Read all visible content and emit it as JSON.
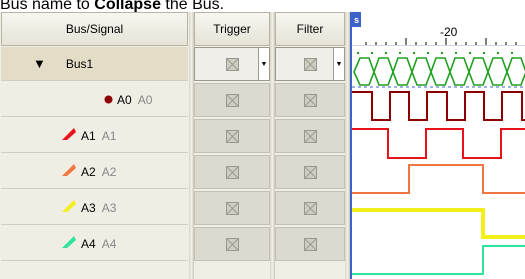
{
  "caption": {
    "prefix": "Bus name to ",
    "action": "Collapse",
    "suffix": " the Bus."
  },
  "headers": {
    "bus_signal": "Bus/Signal",
    "trigger": "Trigger",
    "filter": "Filter"
  },
  "bus": {
    "expander": "▼",
    "name": "Bus1",
    "dropdown_arrow": "▼"
  },
  "signals": [
    {
      "name": "A0",
      "alias": "A0",
      "color": "#8b0000",
      "icon": "probe-dot-icon"
    },
    {
      "name": "A1",
      "alias": "A1",
      "color": "#e8121a",
      "icon": "probe-red-icon"
    },
    {
      "name": "A2",
      "alias": "A2",
      "color": "#f07840",
      "icon": "probe-orange-icon"
    },
    {
      "name": "A3",
      "alias": "A3",
      "color": "#f2ee1a",
      "icon": "probe-yellow-icon"
    },
    {
      "name": "A4",
      "alias": "A4",
      "color": "#2ee39a",
      "icon": "probe-green-icon"
    }
  ],
  "waveform": {
    "ruler_marker": "s",
    "ruler_label": "-20",
    "bus_color": "#20a020"
  }
}
